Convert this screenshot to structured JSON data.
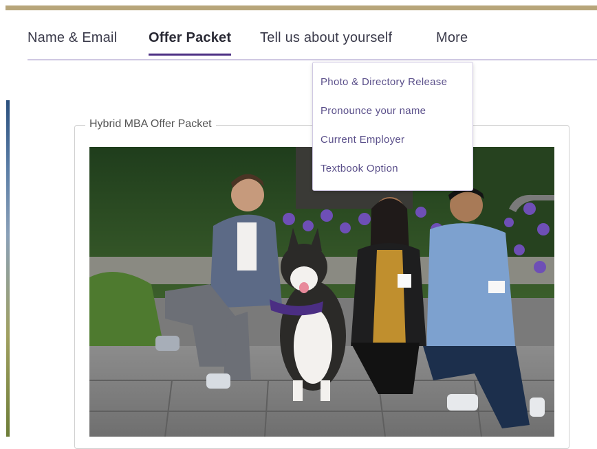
{
  "nav": {
    "tabs": [
      {
        "label": "Name & Email"
      },
      {
        "label": "Offer Packet",
        "active": true
      },
      {
        "label": "Tell us about yourself"
      },
      {
        "label": "More"
      }
    ]
  },
  "dropdown": {
    "items": [
      {
        "label": "Photo & Directory Release"
      },
      {
        "label": "Pronounce your name"
      },
      {
        "label": "Current Employer"
      },
      {
        "label": "Textbook Option"
      }
    ]
  },
  "offer_packet": {
    "legend": "Hybrid MBA Offer Packet"
  },
  "photo": {
    "semantic": "group-photo-with-husky"
  },
  "colors": {
    "accent": "#4b2e83",
    "gold": "#b7a57a",
    "menu_text": "#5a4f8a"
  }
}
